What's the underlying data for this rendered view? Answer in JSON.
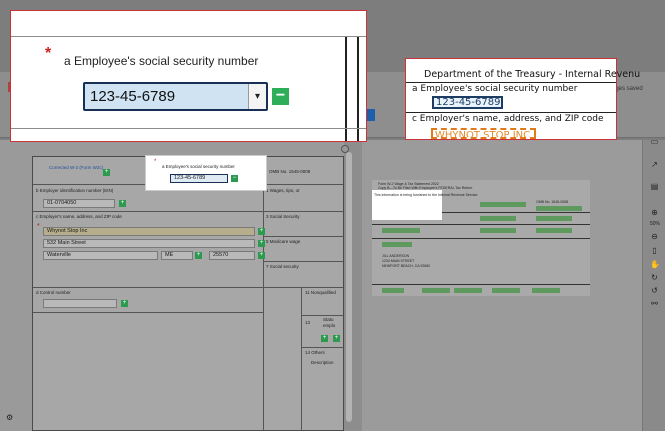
{
  "app": {
    "save_status": "nges saved"
  },
  "zoom_left": {
    "required_marker": "*",
    "ssn_label": "a Employee's social security number",
    "ssn_value": "123-45-6789",
    "dropdown_glyph": "▾",
    "add_button_glyph": "−"
  },
  "zoom_right": {
    "header": "Department of the Treasury - Internal Revenu",
    "field_a_label": "a Employee's social security number",
    "field_a_value": "123-45-6789",
    "field_c_label": "c Employer's name, address, and ZIP code",
    "employer_value": "WHYNOT STOP INC"
  },
  "form_left": {
    "corrected_label": "Corrected W-2 (Form W2c)",
    "omb": "OMB No. 1545-0008",
    "mini_ssn_label": "a Employee's social security number",
    "mini_ssn_value": "123-45-6789",
    "ein_label": "b Employer identification number (EIN)",
    "ein_value": "01-0704050",
    "employer_label": "c Employer's name, address, and ZIP code",
    "employer_name": "Whynot Stop Inc",
    "employer_street": "532 Main Street",
    "employer_city": "Waterville",
    "employer_state": "ME",
    "employer_zip": "25570",
    "control_label": "d Control number",
    "box1_label": "1 Wages, tips, ot",
    "box3_label": "3 Social Security",
    "box5_label": "5 Medicare wage",
    "box7_label": "7 Social security",
    "box11_label": "11 Nonqualified",
    "box13_label": "13",
    "box13_sub1": "Statu",
    "box13_sub2": "emplo",
    "box14_label": "14 Others",
    "box14_desc": "Description"
  },
  "doc": {
    "title": "Form W-2 Wage & Tax Statement 2022",
    "subtitle": "Copy B—To Be Filed With Employee's FEDERAL Tax Return.",
    "note": "This information is being furnished to the Internal Revenue Service.",
    "omb": "OMB No. 1545-0008",
    "employee_name": "JILL ANDERSON",
    "employee_street": "1234 MAIN STREET",
    "employee_city": "NEWPORT BEACH, CA 92660"
  },
  "icons": {
    "rail": [
      "panel-icon",
      "external-link-icon",
      "comment-icon",
      "zoom-in-icon",
      "zoom-out-icon",
      "pan-icon",
      "rotate-icon",
      "settings-icon"
    ],
    "zoom_level": "50%"
  },
  "colors": {
    "accent_green": "#2fae5a",
    "required_red": "#d0201f",
    "popup_border": "#c9343a",
    "highlight_blue": "#cfe3f3"
  }
}
